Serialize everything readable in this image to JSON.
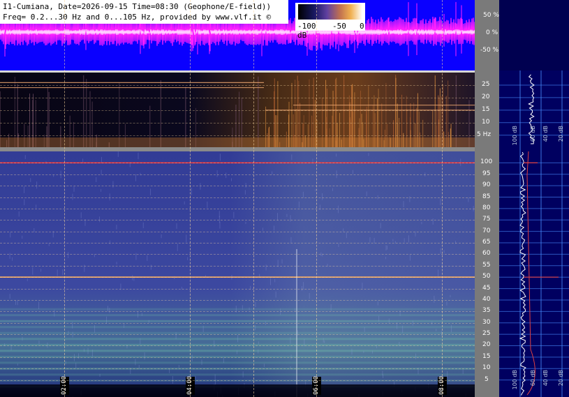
{
  "title": {
    "line1": "I1-Cumiana, Date=2026-09-15 Time=08:30 (Geophone/E-field))",
    "line2": "Freq= 0.2...30 Hz and 0...105 Hz, provided by www.vlf.it ©"
  },
  "colorbar": {
    "labels": [
      "-100 dB",
      "-50",
      "0"
    ]
  },
  "chart_data": [
    {
      "type": "line",
      "panel": "waveform",
      "y_ticks": [
        "50 %",
        "0 %",
        "-50 %"
      ],
      "colors": {
        "background": "#0a00ff",
        "trace": "#ff20ff",
        "trace_core": "#ffffff"
      }
    },
    {
      "type": "heatmap",
      "panel": "spectrogram-low",
      "ylabel": "",
      "y_tick_values": [
        5,
        10,
        15,
        20,
        25
      ],
      "y_ticks": [
        "5 Hz",
        "10",
        "15",
        "20",
        "25"
      ],
      "ylim": [
        0.2,
        30
      ]
    },
    {
      "type": "heatmap",
      "panel": "spectrogram-high",
      "y_tick_values": [
        5,
        10,
        15,
        20,
        25,
        30,
        35,
        40,
        45,
        50,
        55,
        60,
        65,
        70,
        75,
        80,
        85,
        90,
        95,
        100
      ],
      "ylim": [
        0,
        105
      ],
      "x_ticks": [
        "02:00",
        "04:00",
        "06:00",
        "08:00"
      ],
      "lines": [
        {
          "freq": 100,
          "color": "#ff3030"
        },
        {
          "freq": 50,
          "color": "#ffb060"
        }
      ]
    },
    {
      "type": "line",
      "panel": "spectrum-side",
      "x_ticks_low": [
        "100 dB",
        "60 dB",
        "40 dB",
        "20 dB"
      ],
      "x_ticks_high": [
        "100 dB",
        "60 dB",
        "40 dB",
        "20 dB"
      ]
    }
  ]
}
